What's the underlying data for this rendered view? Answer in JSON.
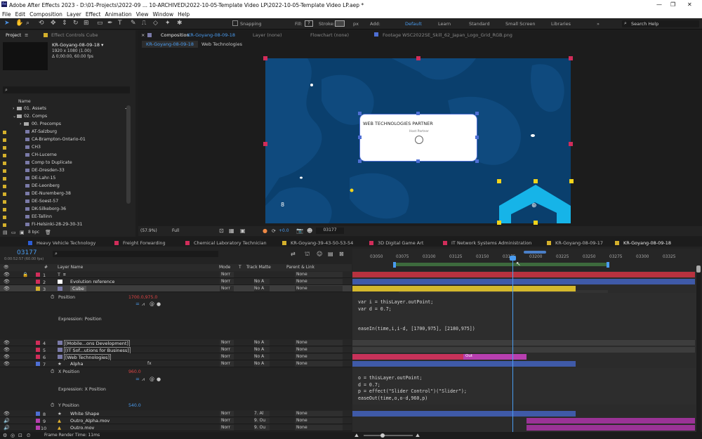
{
  "window": {
    "title": "Adobe After Effects 2023 - D:\\01-Projects\\2022-09 ... 10-ARCHIVED\\2022-10-05-Template Video LP\\2022-10-05-Template Video LP.aep *"
  },
  "menu": [
    "File",
    "Edit",
    "Composition",
    "Layer",
    "Effect",
    "Animation",
    "View",
    "Window",
    "Help"
  ],
  "toolbar": {
    "fill_label": "Fill:",
    "stroke_label": "Stroke:",
    "px": "px",
    "add_label": "Add:",
    "snapping": "Snapping",
    "workspaces": [
      "Default",
      "Learn",
      "Standard",
      "Small Screen",
      "Libraries"
    ],
    "search_placeholder": "Search Help"
  },
  "project": {
    "tab_project": "Project",
    "tab_effects": "Effect Controls Cube",
    "comp_name": "KR-Goyang-08-09-18 ▾",
    "comp_size": "1920 x 1080 (1.00)",
    "comp_dur": "Δ 0;00:00, 60.00 fps",
    "search_placeholder": "",
    "column_name": "Name",
    "items": [
      "01. Assets",
      "02. Comps",
      "00. Precomps",
      "AT-Salzburg",
      "CA-Brampton-Ontario-01",
      "CH3",
      "CH-Lucerne",
      "Comp to Duplicate",
      "DE-Dresden-33",
      "DE-Lahr-15",
      "DE-Leonberg",
      "DE-Nuremberg-38",
      "DE-Soest-57",
      "DK-Silkeborg-36",
      "EE-Tallinn",
      "FI-Helsinki-28-29-30-31"
    ],
    "bpc": "8 bpc"
  },
  "comp": {
    "tab_comp": "Composition",
    "comp_link": "KR-Goyang-08-09-18",
    "tab_layer": "Layer (none)",
    "tab_flow": "Flowchart (none)",
    "tab_footage": "Footage  WSC2022SE_Skill_62_Japan_Logo_Grid_RGB.png",
    "subtabs": [
      "KR-Goyang-08-09-18",
      "Web Technologies"
    ],
    "card_title": "WEB TECHNOLOGIES PARTNER",
    "card_sub": "Host Partner",
    "number_8": "8",
    "zoom": "(57.9%)",
    "resolution": "Full",
    "exposure": "+0.0",
    "frame": "03177"
  },
  "timeline": {
    "tabs": [
      {
        "label": "Heavy Vehicle Technology",
        "color": "#2d5dd6"
      },
      {
        "label": "Freight Forwarding",
        "color": "#d12d5a"
      },
      {
        "label": "Chemical Laboratory Technician",
        "color": "#d12d5a"
      },
      {
        "label": "KR-Goyang-39-43-50-53-54",
        "color": "#d4b02c"
      },
      {
        "label": "3D Digital Game Art",
        "color": "#d12d5a"
      },
      {
        "label": "IT Network Systems Administration",
        "color": "#d12d5a"
      },
      {
        "label": "KR-Goyang-08-09-17",
        "color": "#d4b02c"
      },
      {
        "label": "KR-Goyang-08-09-18",
        "color": "#d4b02c"
      }
    ],
    "current_time": "03177",
    "time_sub": "0:00:52:57 (60.00 fps)",
    "col_layer": "Layer Name",
    "col_mode": "Mode",
    "col_t": "T",
    "col_track": "Track Matte",
    "col_parent": "Parent & Link",
    "ruler": [
      "03050",
      "03075",
      "03100",
      "03125",
      "03150",
      "03175",
      "03200",
      "03225",
      "03250",
      "03275",
      "03300",
      "03325"
    ],
    "layers": [
      {
        "num": "1",
        "name": "",
        "label": "#d12d5a",
        "mode": "Norr",
        "track": "",
        "parent": "None"
      },
      {
        "num": "2",
        "name": "Evolution reference",
        "label": "#d12d5a",
        "mode": "Norr",
        "track": "No A",
        "parent": "None"
      },
      {
        "num": "3",
        "name": "Cube",
        "label": "#d4b02c",
        "mode": "Norr",
        "track": "No A",
        "parent": "None"
      }
    ],
    "position_label": "Position",
    "position_value": "1700.0,975.0",
    "expr_label": "Expression: Position",
    "layers2": [
      {
        "num": "4",
        "name": "[Mobile...ons Development]",
        "label": "#d12d5a",
        "mode": "Norr",
        "track": "No A",
        "parent": "None"
      },
      {
        "num": "5",
        "name": "[IT Sof...utions for Business]",
        "label": "#d12d5a",
        "mode": "Norr",
        "track": "No A",
        "parent": "None"
      },
      {
        "num": "6",
        "name": "[Web Technologies]",
        "label": "#d12d5a",
        "mode": "Norr",
        "track": "No A",
        "parent": "None"
      },
      {
        "num": "7",
        "name": "Alpha",
        "label": "#4e6fd4",
        "mode": "Norr",
        "track": "No A",
        "parent": "None"
      }
    ],
    "xpos_label": "X Position",
    "xpos_value": "960.0",
    "expr2_label": "Expression: X Position",
    "ypos_label": "Y Position",
    "ypos_value": "540.0",
    "layers3": [
      {
        "num": "8",
        "name": "White Shape",
        "label": "#4e6fd4",
        "mode": "Norr",
        "track": "7. Al",
        "parent": "None"
      },
      {
        "num": "9",
        "name": "Outro_Alpha.mov",
        "label": "#b83fb0",
        "mode": "Norr",
        "track": "9. Ou",
        "parent": "None"
      },
      {
        "num": "10",
        "name": "Outro.mov",
        "label": "#b83fb0",
        "mode": "Norr",
        "track": "9. Ou",
        "parent": "None"
      }
    ],
    "code1": "var i = thisLayer.outPoint;\nvar d = 0.7;\n\n\neaseIn(time,i,i-d, [1700,975], [2180,975])",
    "code2": "o = thisLayer.outPoint;\nd = 0.7;\np = effect(\"Slider Control\")(\"Slider\");\neaseOut(time,o,o-d,960,p)",
    "out_label": "Out",
    "render_time": "Frame Render Time: 11ms"
  }
}
